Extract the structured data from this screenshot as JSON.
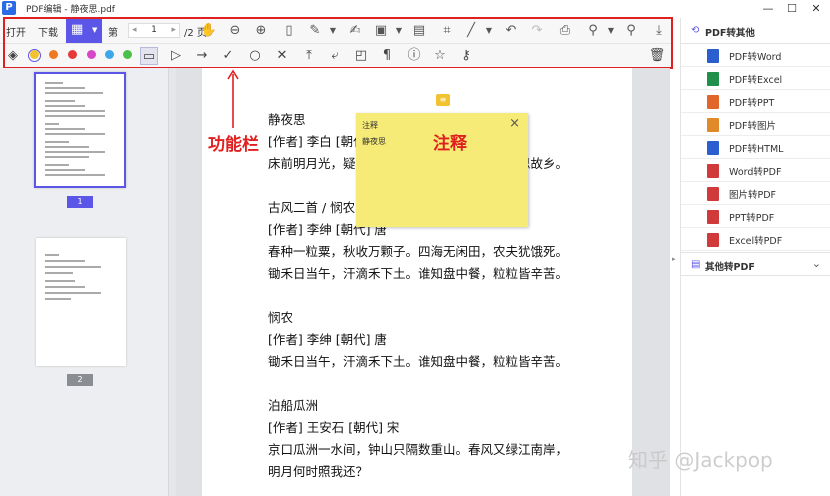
{
  "window": {
    "title": "PDF编辑 - 静夜思.pdf",
    "minimize": "—",
    "maximize": "☐",
    "close": "✕"
  },
  "toolbar": {
    "open_label": "打开",
    "download_label": "下载",
    "page_prefix": "第",
    "page_value": "1",
    "page_total": "/2 页"
  },
  "annotation_colors": [
    "#f2c230",
    "#f07a20",
    "#e63a3a",
    "#d648c8",
    "#3da7e8",
    "#4cc04c"
  ],
  "sidebar": {
    "pages": [
      "1",
      "2"
    ]
  },
  "document": {
    "lines": [
      "静夜思",
      "[作者] 李白  [朝代] 唐",
      "床前明月光，疑是地上霜。举头望明月，低头思故乡。",
      "古风二首 / 悯农",
      "[作者] 李绅  [朝代] 唐",
      "春种一粒粟，秋收万颗子。四海无闲田，农夫犹饿死。",
      "锄禾日当午，汗滴禾下土。谁知盘中餐，粒粒皆辛苦。",
      "悯农",
      "[作者] 李绅  [朝代] 唐",
      "锄禾日当午，汗滴禾下土。谁知盘中餐，粒粒皆辛苦。",
      "泊船瓜洲",
      "[作者] 王安石  [朝代] 宋",
      "京口瓜洲一水间，钟山只隔数重山。春风又绿江南岸，",
      "明月何时照我还？"
    ]
  },
  "note": {
    "title": "注释",
    "content": "静夜思",
    "close": "×"
  },
  "labels": {
    "toolbar_callout": "功能栏",
    "note_callout": "注释"
  },
  "right_panel": {
    "header": "PDF转其他",
    "items": [
      "PDF转Word",
      "PDF转Excel",
      "PDF转PPT",
      "PDF转图片",
      "PDF转HTML",
      "Word转PDF",
      "图片转PDF",
      "PPT转PDF",
      "Excel转PDF"
    ],
    "item_colors": [
      "#2b5fd0",
      "#1f8f4a",
      "#e0662a",
      "#e08a2a",
      "#2b5fd0",
      "#d03a3a",
      "#d03a3a",
      "#d03a3a",
      "#d03a3a"
    ],
    "footer": "其他转PDF"
  },
  "watermark": "知乎 @Jackpop"
}
